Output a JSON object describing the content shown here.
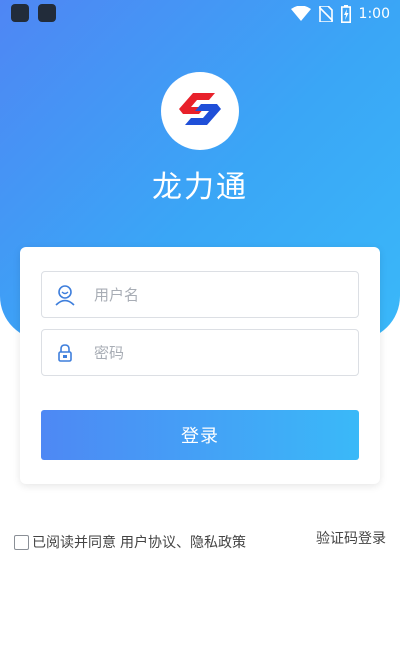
{
  "status_bar": {
    "time": "1:00",
    "icons": [
      "app-notification-icon",
      "app-notification-icon",
      "wifi-icon",
      "no-sim-icon",
      "battery-icon"
    ]
  },
  "app": {
    "name": "龙力通",
    "logo_icon": "s-logo-icon",
    "brand_colors": {
      "primary": "#4f86f4",
      "secondary": "#3ab8f9",
      "logo_red": "#e8212b",
      "logo_blue": "#1f4fd8"
    }
  },
  "login_form": {
    "username_placeholder": "用户名",
    "password_placeholder": "密码",
    "username_icon": "user-icon",
    "password_icon": "lock-icon",
    "submit_label": "登录"
  },
  "agreement": {
    "checked": false,
    "prefix": "已阅读并同意",
    "user_agreement": "用户协议",
    "separator": "、",
    "privacy_policy": "隐私政策"
  },
  "alt_login": {
    "sms_label": "验证码登录"
  }
}
